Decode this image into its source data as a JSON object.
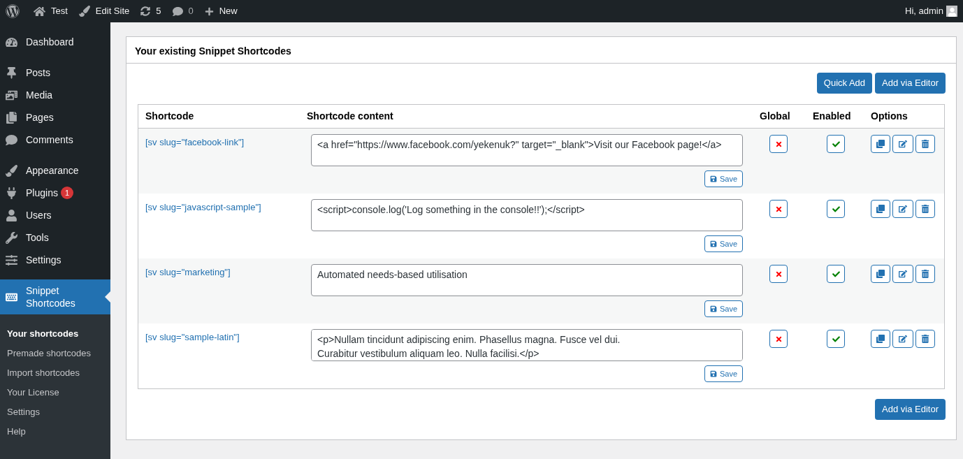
{
  "admin_bar": {
    "site": "Test",
    "edit_site": "Edit Site",
    "updates": "5",
    "comments": "0",
    "new": "New",
    "greeting": "Hi, admin"
  },
  "sidebar": {
    "items": [
      {
        "kind": "dashboard",
        "label": "Dashboard",
        "selected": false
      },
      {
        "kind": "posts",
        "label": "Posts",
        "selected": false
      },
      {
        "kind": "media",
        "label": "Media",
        "selected": false
      },
      {
        "kind": "pages",
        "label": "Pages",
        "selected": false
      },
      {
        "kind": "comments",
        "label": "Comments",
        "selected": false
      },
      {
        "kind": "appearance",
        "label": "Appearance",
        "selected": false
      },
      {
        "kind": "plugins",
        "label": "Plugins",
        "selected": false,
        "badge": "1"
      },
      {
        "kind": "users",
        "label": "Users",
        "selected": false
      },
      {
        "kind": "tools",
        "label": "Tools",
        "selected": false
      },
      {
        "kind": "settings",
        "label": "Settings",
        "selected": false
      },
      {
        "kind": "snippets",
        "label": "Snippet Shortcodes",
        "selected": true
      }
    ],
    "submenu": [
      {
        "label": "Your shortcodes",
        "selected": true
      },
      {
        "label": "Premade shortcodes",
        "selected": false
      },
      {
        "label": "Import shortcodes",
        "selected": false
      },
      {
        "label": "Your License",
        "selected": false
      },
      {
        "label": "Settings",
        "selected": false
      },
      {
        "label": "Help",
        "selected": false
      }
    ]
  },
  "panel": {
    "title": "Your existing Snippet Shortcodes",
    "top_buttons": [
      "Quick Add",
      "Add via Editor"
    ],
    "bottom_button": "Add via Editor"
  },
  "table": {
    "columns": [
      "Shortcode",
      "Shortcode content",
      "Global",
      "Enabled",
      "Options"
    ],
    "rows": [
      {
        "shortcode": "[sv slug=\"facebook-link\"]",
        "content": "<a href=\"https://www.facebook.com/yekenuk?\" target=\"_blank\">Visit our Facebook page!</a>",
        "save_label": "Save",
        "global": false,
        "enabled": true
      },
      {
        "shortcode": "[sv slug=\"javascript-sample\"]",
        "content": "<script>console.log('Log something in the console!!');</script>",
        "save_label": "Save",
        "global": false,
        "enabled": true
      },
      {
        "shortcode": "[sv slug=\"marketing\"]",
        "content": "Automated needs-based utilisation",
        "save_label": "Save",
        "global": false,
        "enabled": true
      },
      {
        "shortcode": "[sv slug=\"sample-latin\"]",
        "content": "<p>Nullam tincidunt adipiscing enim. Phasellus magna. Fusce vel dui.\nCurabitur vestibulum aliquam leo. Nulla facilisi.</p>",
        "save_label": "Save",
        "global": false,
        "enabled": true
      }
    ]
  }
}
